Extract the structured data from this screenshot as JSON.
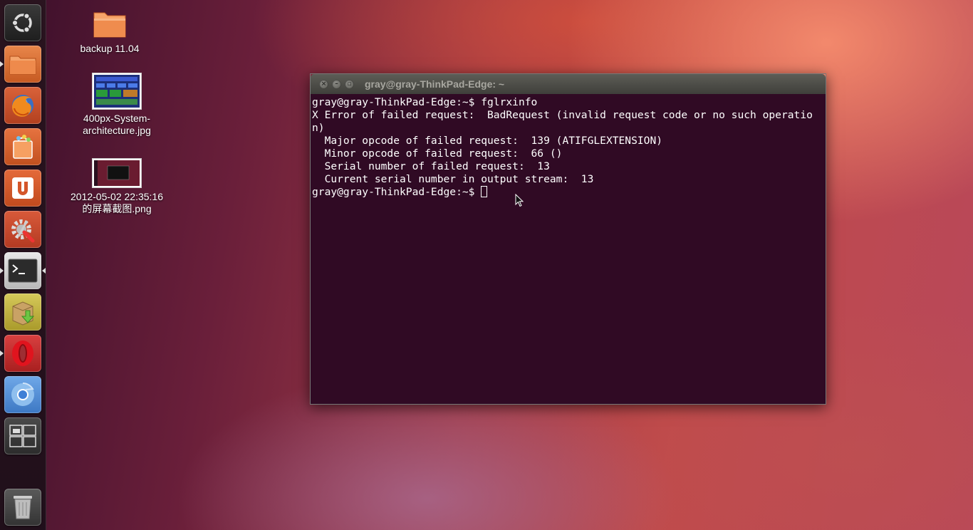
{
  "launcher": {
    "items": [
      {
        "name": "dash-home",
        "icon": "ubuntu-logo-icon"
      },
      {
        "name": "home-folder",
        "icon": "folder-icon"
      },
      {
        "name": "firefox",
        "icon": "firefox-icon"
      },
      {
        "name": "software-center",
        "icon": "shopping-bag-icon"
      },
      {
        "name": "ubuntu-one",
        "icon": "ubuntu-one-icon"
      },
      {
        "name": "system-settings",
        "icon": "settings-wrench-icon"
      },
      {
        "name": "terminal",
        "icon": "terminal-icon",
        "running": true,
        "focused": true
      },
      {
        "name": "archive-manager",
        "icon": "package-download-icon"
      },
      {
        "name": "opera",
        "icon": "opera-icon",
        "running": true
      },
      {
        "name": "chromium",
        "icon": "chromium-icon"
      },
      {
        "name": "workspace-switcher",
        "icon": "workspaces-icon"
      },
      {
        "name": "trash",
        "icon": "trash-icon"
      }
    ]
  },
  "desktop": {
    "icons": [
      {
        "label": "backup 11.04",
        "icon": "folder-icon"
      },
      {
        "label_line1": "400px-System-",
        "label_line2": "architecture.jpg",
        "icon": "image-thumbnail-icon"
      },
      {
        "label_line1": "2012-05-02 22:35:16",
        "label_line2": "的屏幕截图.png",
        "icon": "screenshot-thumbnail-icon"
      }
    ]
  },
  "terminal": {
    "title": "gray@gray-ThinkPad-Edge: ~",
    "lines": [
      "gray@gray-ThinkPad-Edge:~$ fglrxinfo",
      "X Error of failed request:  BadRequest (invalid request code or no such operatio",
      "n)",
      "  Major opcode of failed request:  139 (ATIFGLEXTENSION)",
      "  Minor opcode of failed request:  66 ()",
      "  Serial number of failed request:  13",
      "  Current serial number in output stream:  13"
    ],
    "prompt": "gray@gray-ThinkPad-Edge:~$ ",
    "colors": {
      "background": "#300a24",
      "foreground": "#ffffff"
    }
  }
}
